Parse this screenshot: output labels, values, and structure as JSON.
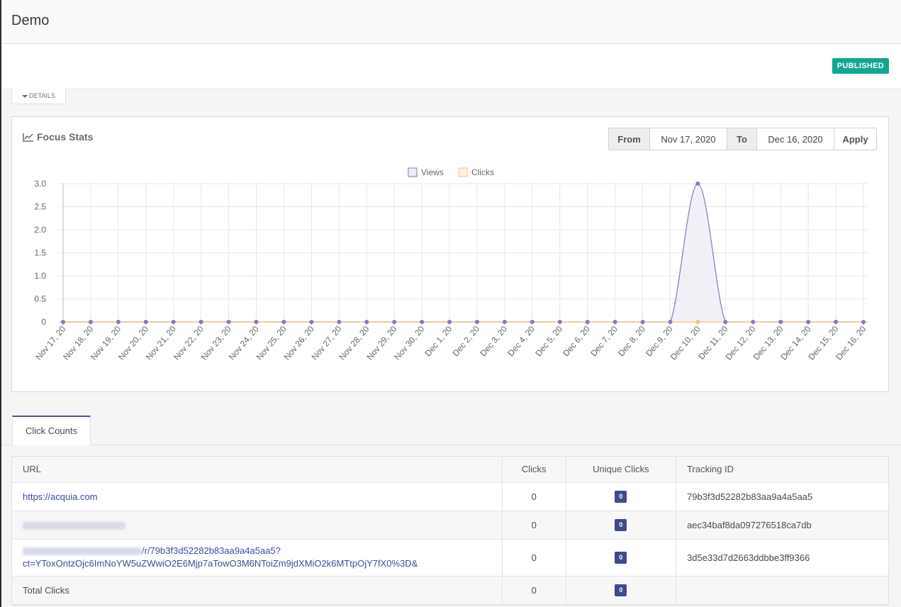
{
  "page": {
    "title": "Demo",
    "status_badge": "PUBLISHED",
    "details_toggle": "DETAILS"
  },
  "stats": {
    "title": "Focus Stats",
    "from_label": "From",
    "from_value": "Nov 17, 2020",
    "to_label": "To",
    "to_value": "Dec 16, 2020",
    "apply_label": "Apply"
  },
  "chart_data": {
    "type": "area",
    "categories": [
      "Nov 17, 20",
      "Nov 18, 20",
      "Nov 19, 20",
      "Nov 20, 20",
      "Nov 21, 20",
      "Nov 22, 20",
      "Nov 23, 20",
      "Nov 24, 20",
      "Nov 25, 20",
      "Nov 26, 20",
      "Nov 27, 20",
      "Nov 28, 20",
      "Nov 29, 20",
      "Nov 30, 20",
      "Dec 1, 20",
      "Dec 2, 20",
      "Dec 3, 20",
      "Dec 4, 20",
      "Dec 5, 20",
      "Dec 6, 20",
      "Dec 7, 20",
      "Dec 8, 20",
      "Dec 9, 20",
      "Dec 10, 20",
      "Dec 11, 20",
      "Dec 12, 20",
      "Dec 13, 20",
      "Dec 14, 20",
      "Dec 15, 20",
      "Dec 16, 20"
    ],
    "series": [
      {
        "name": "Views",
        "color": "#7a80b8",
        "fill": "#ececf4",
        "values": [
          0,
          0,
          0,
          0,
          0,
          0,
          0,
          0,
          0,
          0,
          0,
          0,
          0,
          0,
          0,
          0,
          0,
          0,
          0,
          0,
          0,
          0,
          0,
          3,
          0,
          0,
          0,
          0,
          0,
          0
        ]
      },
      {
        "name": "Clicks",
        "color": "#f5c27a",
        "fill": "#fdf2e0",
        "values": [
          0,
          0,
          0,
          0,
          0,
          0,
          0,
          0,
          0,
          0,
          0,
          0,
          0,
          0,
          0,
          0,
          0,
          0,
          0,
          0,
          0,
          0,
          0,
          0,
          0,
          0,
          0,
          0,
          0,
          0
        ]
      }
    ],
    "yticks": [
      "3.0",
      "2.5",
      "2.0",
      "1.5",
      "1.0",
      "0.5",
      "0"
    ],
    "ylim": [
      0,
      3
    ],
    "grid": true,
    "legend_position": "top-center"
  },
  "click_counts": {
    "tab_label": "Click Counts",
    "headers": [
      "URL",
      "Clicks",
      "Unique Clicks",
      "Tracking ID"
    ],
    "rows": [
      {
        "url": "https://acquia.com",
        "clicks": "0",
        "unique": "0",
        "tracking_id": "79b3f3d52282b83aa9a4a5aa5"
      },
      {
        "url": "",
        "clicks": "0",
        "unique": "0",
        "tracking_id": "aec34baf8da097276518ca7db"
      },
      {
        "url_line1": "/r/79b3f3d52282b83aa9a4a5aa5?",
        "url_line2": "ct=YToxOntzOjc6ImNoYW5uZWwiO2E6Mjp7aTowO3M6NToiZm9jdXMiO2k6MTtpOjY7fX0%3D&",
        "clicks": "0",
        "unique": "0",
        "tracking_id": "3d5e33d7d2663ddbbe3ff9366"
      }
    ],
    "total": {
      "label": "Total Clicks",
      "clicks": "0",
      "unique": "0"
    }
  }
}
